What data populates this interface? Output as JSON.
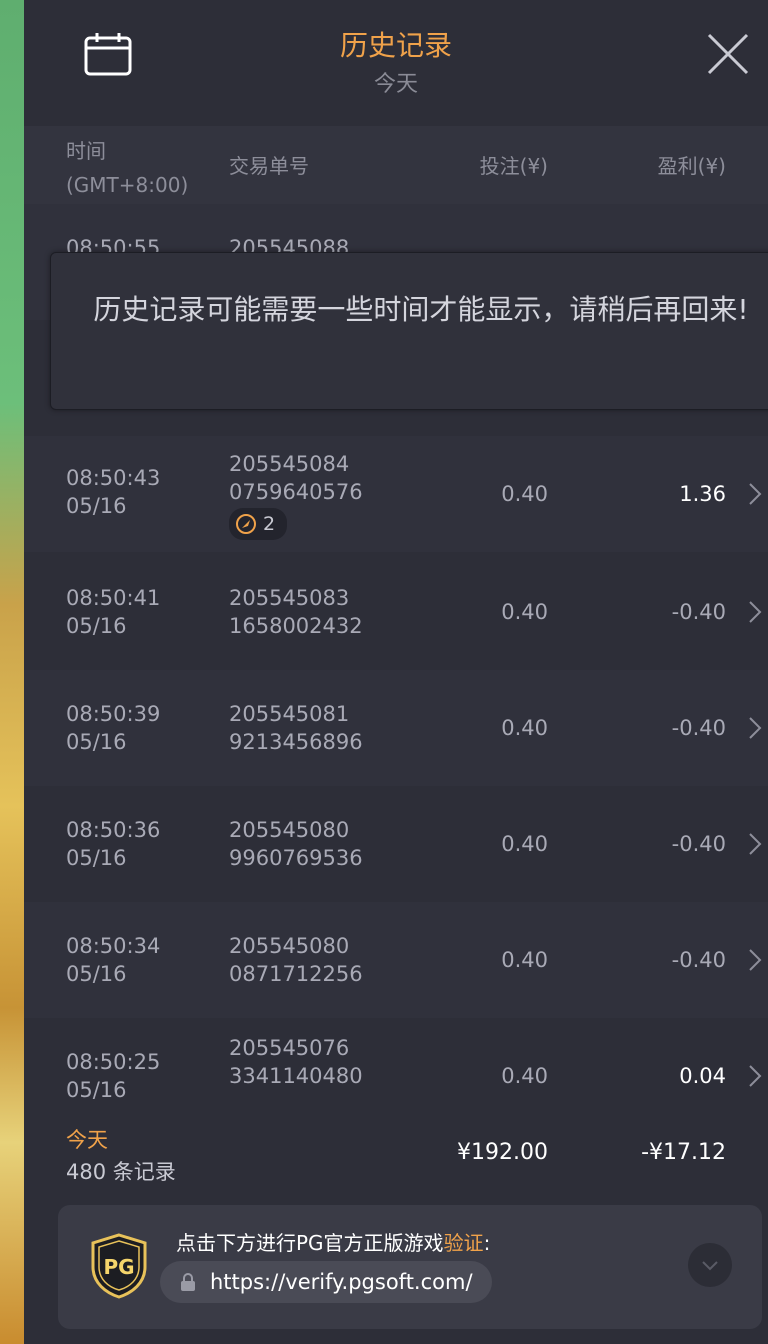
{
  "header": {
    "title": "历史记录",
    "subtitle": "今天"
  },
  "columns": {
    "time_line1": "时间",
    "time_line2": "(GMT+8:00)",
    "order": "交易单号",
    "bet": "投注(¥)",
    "profit": "盈利(¥)"
  },
  "partial_row": {
    "time": "08:50:55",
    "order": "205545088"
  },
  "toast": {
    "message": "历史记录可能需要一些时间才能显示，请稍后再回来!"
  },
  "rows": [
    {
      "time": "08:50:43",
      "date": "05/16",
      "order1": "205545084",
      "order2": "0759640576",
      "badge": "2",
      "bet": "0.40",
      "profit": "1.36",
      "positive": true
    },
    {
      "time": "08:50:41",
      "date": "05/16",
      "order1": "205545083",
      "order2": "1658002432",
      "badge": "",
      "bet": "0.40",
      "profit": "-0.40",
      "positive": false
    },
    {
      "time": "08:50:39",
      "date": "05/16",
      "order1": "205545081",
      "order2": "9213456896",
      "badge": "",
      "bet": "0.40",
      "profit": "-0.40",
      "positive": false
    },
    {
      "time": "08:50:36",
      "date": "05/16",
      "order1": "205545080",
      "order2": "9960769536",
      "badge": "",
      "bet": "0.40",
      "profit": "-0.40",
      "positive": false
    },
    {
      "time": "08:50:34",
      "date": "05/16",
      "order1": "205545080",
      "order2": "0871712256",
      "badge": "",
      "bet": "0.40",
      "profit": "-0.40",
      "positive": false
    },
    {
      "time": "08:50:25",
      "date": "05/16",
      "order1": "205545076",
      "order2": "3341140480",
      "badge": "",
      "bet": "0.40",
      "profit": "0.04",
      "positive": true
    }
  ],
  "summary": {
    "label": "今天",
    "count": "480 条记录",
    "total_bet": "¥192.00",
    "total_profit": "-¥17.12"
  },
  "verify": {
    "text_main": "点击下方进行PG官方正版游戏",
    "text_highlight": "验证",
    "text_colon": ":",
    "url": "https://verify.pgsoft.com/",
    "logo_text": "PG"
  },
  "colors": {
    "accent": "#f0a24a",
    "background": "#2d2e38",
    "row_alt": "#30313c"
  }
}
